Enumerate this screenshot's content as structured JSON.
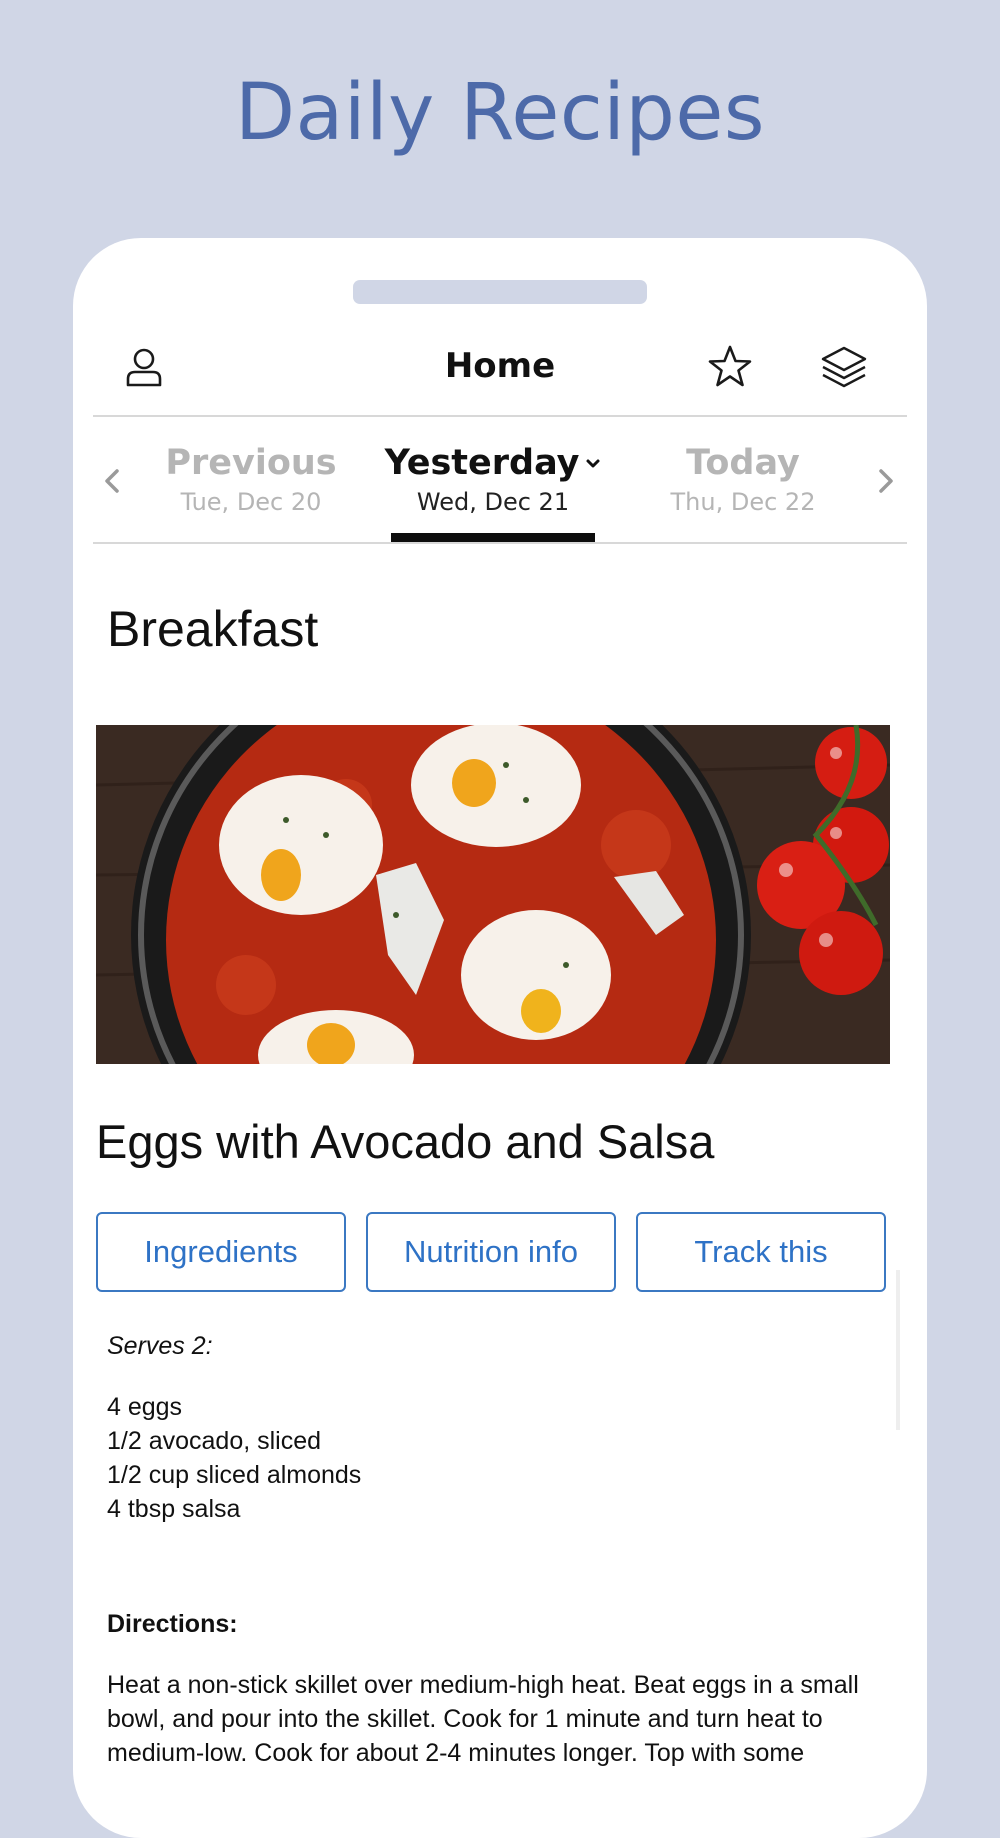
{
  "promo": {
    "title": "Daily Recipes"
  },
  "header": {
    "title": "Home",
    "icons": {
      "profile": "person-icon",
      "favorites": "star-icon",
      "layers": "layers-icon"
    }
  },
  "days": {
    "previous": {
      "label": "Previous",
      "date": "Tue, Dec 20"
    },
    "current": {
      "label": "Yesterday",
      "date": "Wed, Dec 21"
    },
    "next": {
      "label": "Today",
      "date": "Thu, Dec 22"
    }
  },
  "meal": {
    "section": "Breakfast",
    "image": "shakshuka-eggs-photo",
    "title": "Eggs with Avocado and Salsa",
    "buttons": {
      "ingredients": "Ingredients",
      "nutrition": "Nutrition info",
      "track": "Track this"
    },
    "serves": "Serves 2:",
    "ingredients": [
      "4 eggs",
      "1/2 avocado, sliced",
      "1/2 cup sliced almonds",
      "4 tbsp salsa"
    ],
    "directions_label": "Directions:",
    "directions": "Heat a non-stick skillet over medium-high heat. Beat eggs in a small bowl, and pour into the skillet. Cook for 1 minute and turn heat to medium-low. Cook for about 2-4 minutes longer. Top with some"
  },
  "colors": {
    "background": "#d0d6e6",
    "promo_title": "#4d6aa9",
    "accent": "#2e72c6",
    "active_underline": "#0d0d0d"
  }
}
